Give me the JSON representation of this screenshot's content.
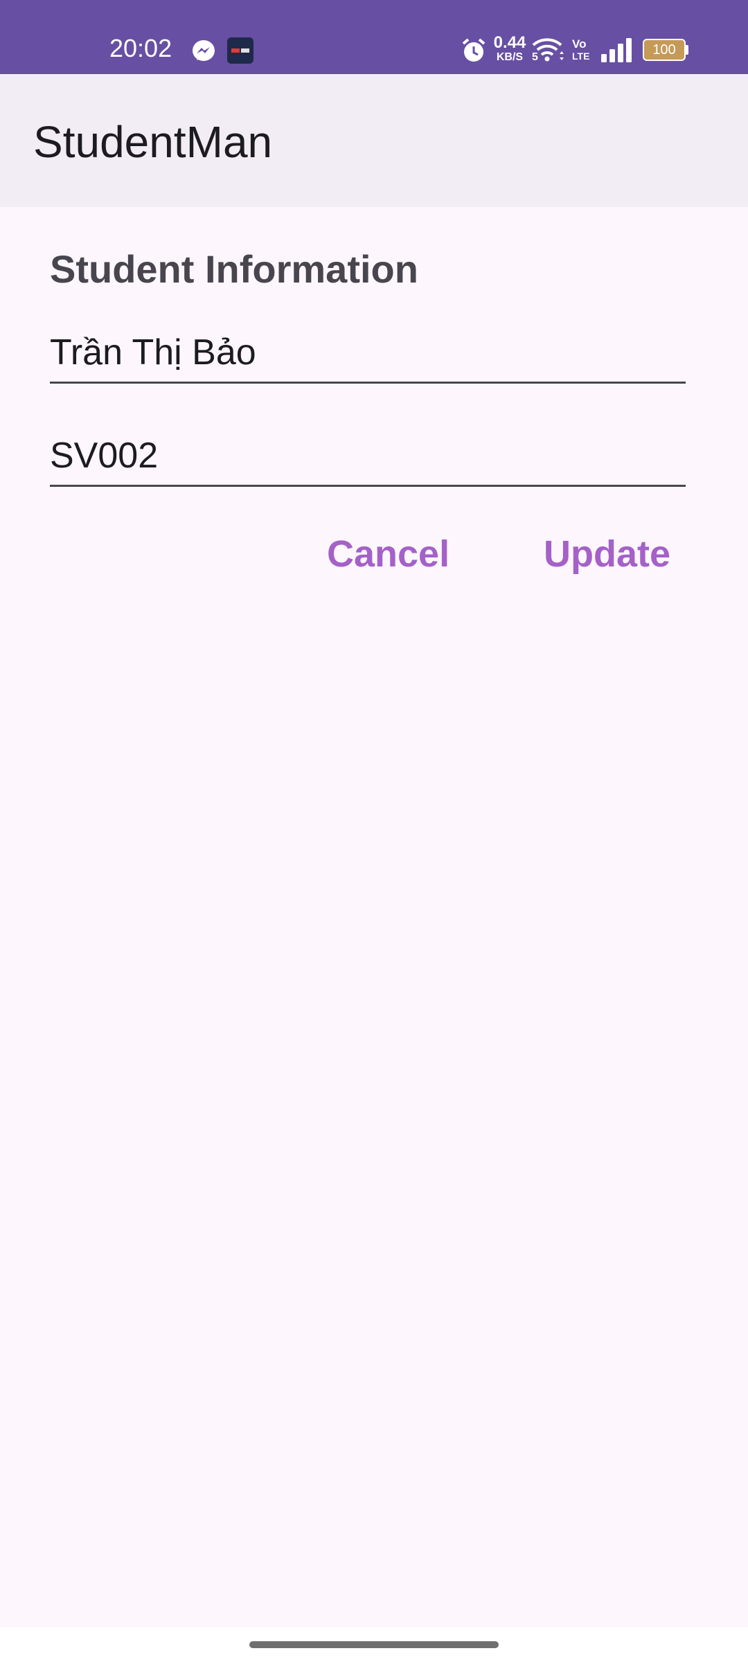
{
  "status_bar": {
    "time": "20:02",
    "net_speed_value": "0.44",
    "net_speed_unit": "KB/S",
    "wifi_label": "5",
    "volte_label_top": "Vo",
    "volte_label_bottom": "LTE",
    "battery_level": "100",
    "notification_icons": [
      "messenger-icon",
      "app-notification-icon"
    ],
    "system_icons": [
      "alarm-icon",
      "wifi-icon",
      "volte-icon",
      "signal-icon",
      "battery-icon"
    ]
  },
  "app_bar": {
    "title": "StudentMan"
  },
  "form": {
    "heading": "Student Information",
    "name_value": "Trần Thị Bảo",
    "id_value": "SV002",
    "cancel_label": "Cancel",
    "update_label": "Update"
  },
  "colors": {
    "status_bar": "#674FA3",
    "app_bar": "#F2ECF5",
    "background": "#FDF7FD",
    "accent": "#A461C8",
    "text": "#1C1B1F",
    "heading": "#48454E"
  }
}
